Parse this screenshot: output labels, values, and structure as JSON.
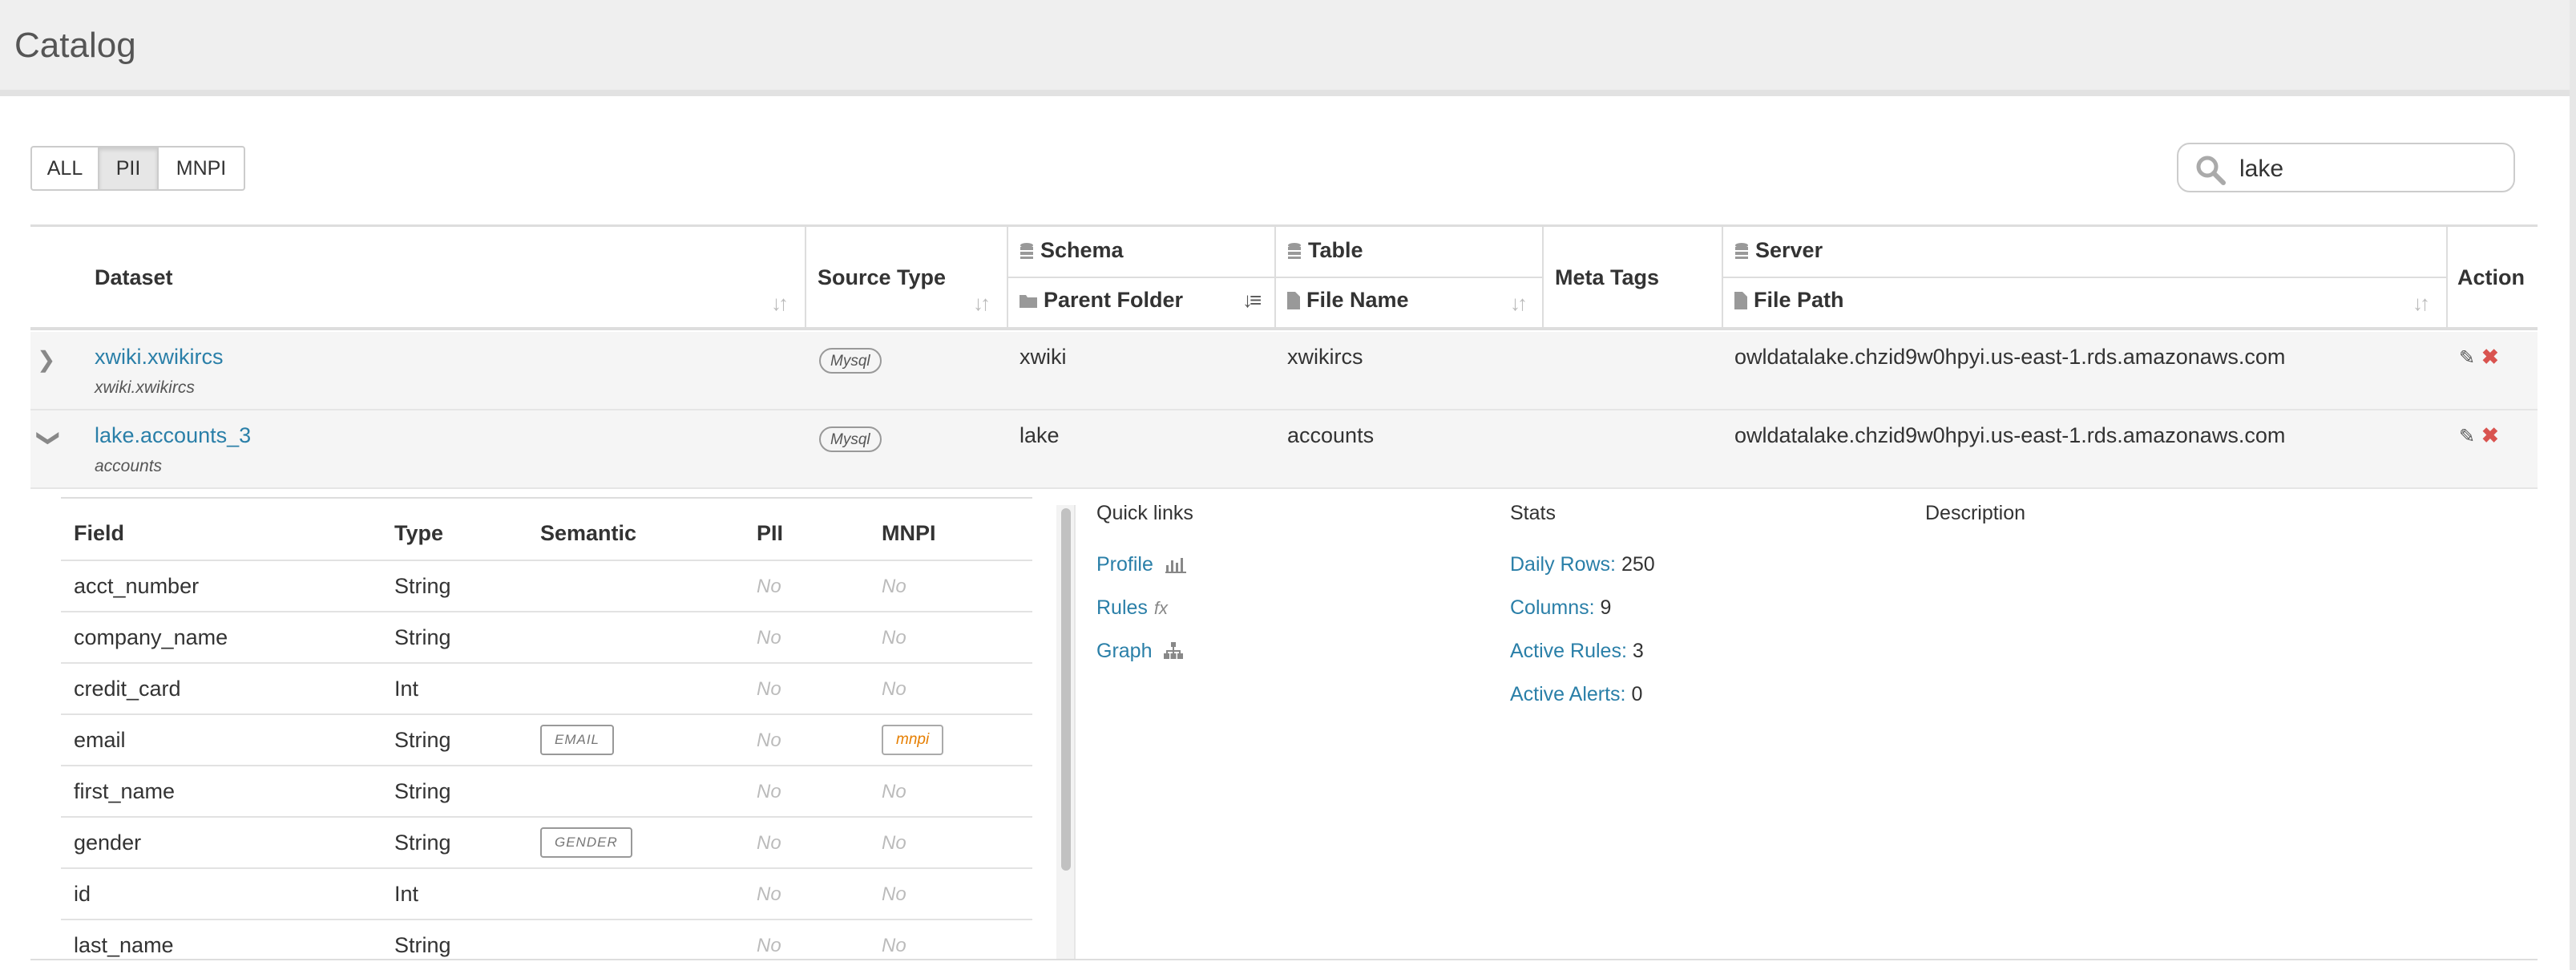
{
  "page": {
    "title": "Catalog"
  },
  "filters": {
    "all": "ALL",
    "pii": "PII",
    "mnpi": "MNPI",
    "active": "PII"
  },
  "search": {
    "value": "lake"
  },
  "table": {
    "headers": {
      "dataset": "Dataset",
      "source_type": "Source Type",
      "schema": "Schema",
      "parent_folder": "Parent Folder",
      "table": "Table",
      "file_name": "File Name",
      "meta_tags": "Meta Tags",
      "server": "Server",
      "file_path": "File Path",
      "action": "Action"
    },
    "rows": [
      {
        "dataset": "xwiki.xwikircs",
        "sub": "xwiki.xwikircs",
        "source": "Mysql",
        "schema": "xwiki",
        "table": "xwikircs",
        "server": "owldatalake.chzid9w0hpyi.us-east-1.rds.amazonaws.com",
        "expanded": false
      },
      {
        "dataset": "lake.accounts_3",
        "sub": "accounts",
        "source": "Mysql",
        "schema": "lake",
        "table": "accounts",
        "server": "owldatalake.chzid9w0hpyi.us-east-1.rds.amazonaws.com",
        "expanded": true
      }
    ]
  },
  "detail": {
    "fields_header": {
      "field": "Field",
      "type": "Type",
      "semantic": "Semantic",
      "pii": "PII",
      "mnpi": "MNPI"
    },
    "fields": [
      {
        "field": "acct_number",
        "type": "String",
        "semantic": "",
        "pii": "No",
        "mnpi": "No",
        "mnpi_tag": ""
      },
      {
        "field": "company_name",
        "type": "String",
        "semantic": "",
        "pii": "No",
        "mnpi": "No",
        "mnpi_tag": ""
      },
      {
        "field": "credit_card",
        "type": "Int",
        "semantic": "",
        "pii": "No",
        "mnpi": "No",
        "mnpi_tag": ""
      },
      {
        "field": "email",
        "type": "String",
        "semantic": "EMAIL",
        "pii": "No",
        "mnpi": "",
        "mnpi_tag": "mnpi"
      },
      {
        "field": "first_name",
        "type": "String",
        "semantic": "",
        "pii": "No",
        "mnpi": "No",
        "mnpi_tag": ""
      },
      {
        "field": "gender",
        "type": "String",
        "semantic": "GENDER",
        "pii": "No",
        "mnpi": "No",
        "mnpi_tag": ""
      },
      {
        "field": "id",
        "type": "Int",
        "semantic": "",
        "pii": "No",
        "mnpi": "No",
        "mnpi_tag": ""
      },
      {
        "field": "last_name",
        "type": "String",
        "semantic": "",
        "pii": "No",
        "mnpi": "No",
        "mnpi_tag": ""
      }
    ],
    "quick_links": {
      "title": "Quick links",
      "profile": "Profile",
      "rules": "Rules",
      "rules_icon": "fx",
      "graph": "Graph"
    },
    "stats": {
      "title": "Stats",
      "daily_rows_label": "Daily Rows:",
      "daily_rows": "250",
      "columns_label": "Columns:",
      "columns": "9",
      "active_rules_label": "Active Rules:",
      "active_rules": "3",
      "active_alerts_label": "Active Alerts:",
      "active_alerts": "0"
    },
    "description": {
      "title": "Description"
    }
  },
  "icons": {
    "search": "search-icon",
    "sort": "sort-icon",
    "database": "database-icon",
    "folder": "folder-icon",
    "file": "file-icon",
    "edit": "edit-icon",
    "delete": "delete-icon",
    "chevron_right": "chevron-right-icon",
    "chevron_down": "chevron-down-icon",
    "bar_chart": "bar-chart-icon",
    "sitemap": "sitemap-icon"
  },
  "colors": {
    "link": "#2a7fa8",
    "delete": "#d9534f",
    "mnpi_tag": "#e67e00"
  }
}
